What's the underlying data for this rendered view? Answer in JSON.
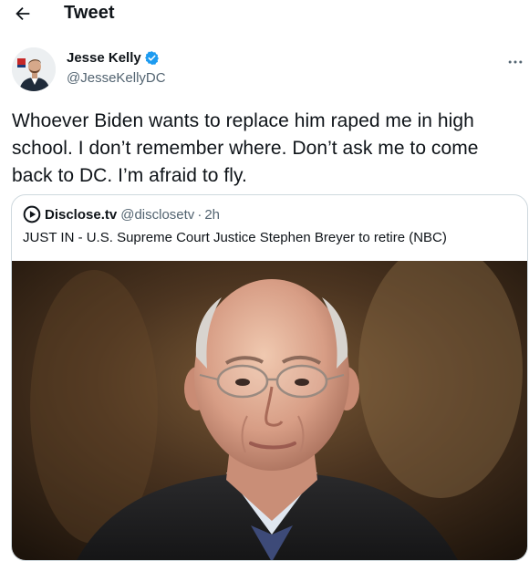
{
  "header": {
    "title": "Tweet",
    "back_icon": "arrow-left-icon"
  },
  "author": {
    "display_name": "Jesse Kelly",
    "handle": "@JesseKellyDC",
    "verified": true,
    "verified_color": "#1d9bf0",
    "more_icon": "more-horizontal-icon"
  },
  "tweet": {
    "text": "Whoever Biden wants to replace him raped me in high school. I don’t remember where. Don’t ask me to come back to DC. I’m afraid to fly."
  },
  "quote": {
    "source_name": "Disclose.tv",
    "source_handle": "@disclosetv",
    "separator": "·",
    "time": "2h",
    "text": "JUST IN - U.S. Supreme Court Justice Stephen Breyer to retire (NBC)"
  }
}
